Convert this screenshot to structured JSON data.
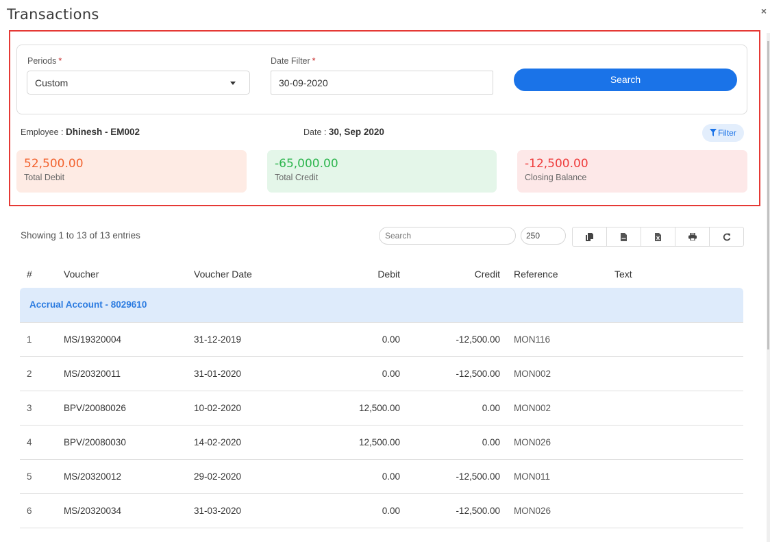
{
  "header": {
    "title": "Transactions",
    "close_icon": "×"
  },
  "filters": {
    "periods_label": "Periods",
    "periods_required": "*",
    "periods_value": "Custom",
    "date_filter_label": "Date Filter",
    "date_filter_required": "*",
    "date_filter_value": "30-09-2020",
    "search_button": "Search"
  },
  "info": {
    "employee_label": "Employee : ",
    "employee_value": "Dhinesh - EM002",
    "date_label": "Date : ",
    "date_value": "30, Sep 2020",
    "filter_button": "Filter"
  },
  "stats": {
    "total_debit_value": "52,500.00",
    "total_debit_label": "Total Debit",
    "total_credit_value": "-65,000.00",
    "total_credit_label": "Total Credit",
    "closing_balance_value": "-12,500.00",
    "closing_balance_label": "Closing Balance",
    "colors": {
      "debit": "#f2622e",
      "credit": "#2db54e",
      "closing": "#ee3b3b"
    }
  },
  "table_controls": {
    "showing_text": "Showing 1 to 13 of 13 entries",
    "search_placeholder": "Search",
    "page_length": "250",
    "buttons": [
      "copy-icon",
      "csv-icon",
      "excel-icon",
      "print-icon",
      "refresh-icon"
    ]
  },
  "table": {
    "columns": [
      "#",
      "Voucher",
      "Voucher Date",
      "Debit",
      "Credit",
      "Reference",
      "Text"
    ],
    "group_label": "Accrual Account - 8029610",
    "rows": [
      {
        "idx": "1",
        "voucher": "MS/19320004",
        "date": "31-12-2019",
        "debit": "0.00",
        "credit": "-12,500.00",
        "reference": "MON116",
        "text": ""
      },
      {
        "idx": "2",
        "voucher": "MS/20320011",
        "date": "31-01-2020",
        "debit": "0.00",
        "credit": "-12,500.00",
        "reference": "MON002",
        "text": ""
      },
      {
        "idx": "3",
        "voucher": "BPV/20080026",
        "date": "10-02-2020",
        "debit": "12,500.00",
        "credit": "0.00",
        "reference": "MON002",
        "text": ""
      },
      {
        "idx": "4",
        "voucher": "BPV/20080030",
        "date": "14-02-2020",
        "debit": "12,500.00",
        "credit": "0.00",
        "reference": "MON026",
        "text": ""
      },
      {
        "idx": "5",
        "voucher": "MS/20320012",
        "date": "29-02-2020",
        "debit": "0.00",
        "credit": "-12,500.00",
        "reference": "MON011",
        "text": ""
      },
      {
        "idx": "6",
        "voucher": "MS/20320034",
        "date": "31-03-2020",
        "debit": "0.00",
        "credit": "-12,500.00",
        "reference": "MON026",
        "text": ""
      }
    ]
  }
}
